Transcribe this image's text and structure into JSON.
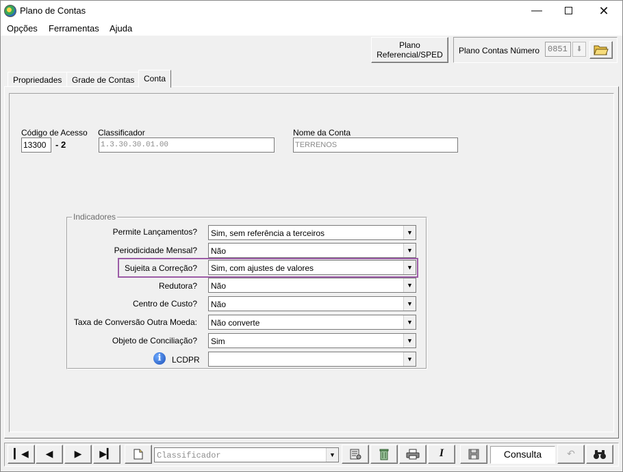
{
  "window": {
    "title": "Plano de Contas"
  },
  "menu": {
    "items": [
      "Opções",
      "Ferramentas",
      "Ajuda"
    ]
  },
  "toolbar": {
    "plano_ref_line1": "Plano",
    "plano_ref_line2": "Referencial/SPED",
    "plano_contas_label": "Plano Contas Número",
    "plano_contas_numero": "0851"
  },
  "tabs": [
    "Propriedades",
    "Grade de Contas",
    "Conta"
  ],
  "conta": {
    "codigo_label": "Código de Acesso",
    "codigo_value": "13300",
    "codigo_digit": "- 2",
    "classificador_label": "Classificador",
    "classificador_value": "1.3.30.30.01.00",
    "nome_label": "Nome da Conta",
    "nome_value": "TERRENOS"
  },
  "indicadores": {
    "title": "Indicadores",
    "rows": [
      {
        "label": "Permite Lançamentos?",
        "value": "Sim, sem referência a terceiros"
      },
      {
        "label": "Periodicidade Mensal?",
        "value": "Não"
      },
      {
        "label": "Sujeita a Correção?",
        "value": "Sim, com ajustes de valores"
      },
      {
        "label": "Redutora?",
        "value": "Não"
      },
      {
        "label": "Centro de Custo?",
        "value": "Não"
      },
      {
        "label": "Taxa de Conversão Outra Moeda:",
        "value": "Não converte"
      },
      {
        "label": "Objeto de Conciliação?",
        "value": "Sim"
      },
      {
        "label": "LCDPR",
        "value": ""
      }
    ],
    "highlight_color": "#9b5ba6"
  },
  "bottom": {
    "classificador_placeholder": "Classificador",
    "mode": "Consulta"
  },
  "icons": [
    "app-globe-icon",
    "folder-open-icon",
    "info-icon",
    "first-record-icon",
    "prev-record-icon",
    "next-record-icon",
    "last-record-icon",
    "new-document-icon",
    "options-icon",
    "delete-icon",
    "print-icon",
    "italic-icon",
    "save-icon",
    "undo-icon",
    "binoculars-icon"
  ]
}
